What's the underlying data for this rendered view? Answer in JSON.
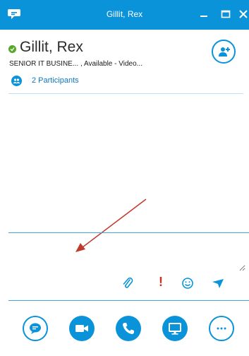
{
  "window": {
    "title": "Gillit, Rex"
  },
  "contact": {
    "name": "Gillit, Rex",
    "presence": "Available",
    "status_line": "SENIOR IT BUSINE... , Available - Video...",
    "participants_label": "2 Participants"
  },
  "compose": {
    "placeholder": ""
  },
  "icons": {
    "app": "skype-chat-icon",
    "add_people": "add-people-icon",
    "attach": "paperclip-icon",
    "important": "exclamation-icon",
    "emoticon": "smiley-icon",
    "send": "send-icon",
    "im": "chat-bubble-icon",
    "video": "video-camera-icon",
    "call": "phone-icon",
    "share": "monitor-icon",
    "more": "ellipsis-icon"
  },
  "colors": {
    "accent": "#0a93d9",
    "presence_available": "#57a82a",
    "important": "#e0281b",
    "annotation_arrow": "#c0392b"
  }
}
